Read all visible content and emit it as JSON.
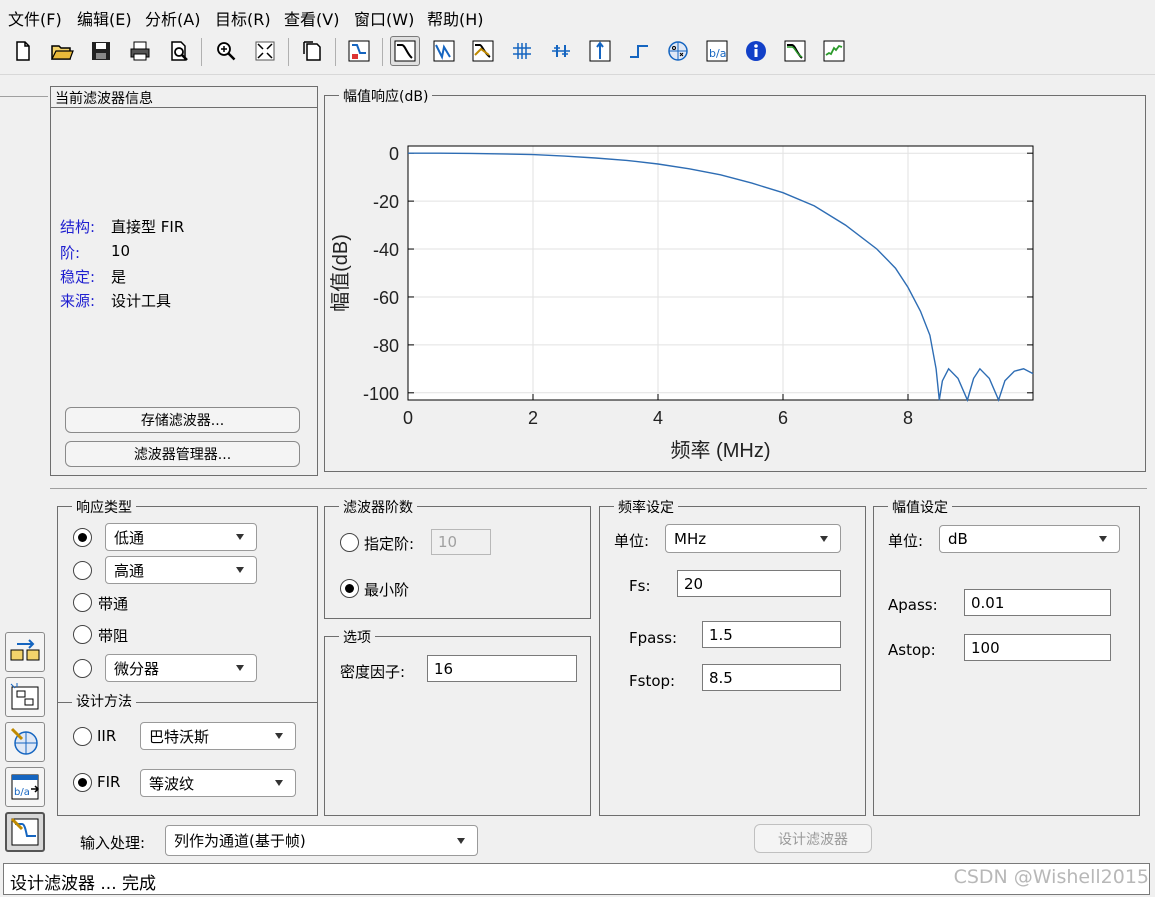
{
  "menu": [
    {
      "label": "文件(F)"
    },
    {
      "label": "编辑(E)"
    },
    {
      "label": "分析(A)"
    },
    {
      "label": "目标(R)"
    },
    {
      "label": "查看(V)"
    },
    {
      "label": "窗口(W)"
    },
    {
      "label": "帮助(H)"
    }
  ],
  "toolbar_icons": [
    "new-file-icon",
    "open-folder-icon",
    "save-icon",
    "print-icon",
    "print-preview-icon",
    "zoom-in-icon",
    "full-view-icon",
    "new-window-icon",
    "filter-spec-icon",
    "magnitude-response-icon",
    "phase-response-icon",
    "magnitude-phase-icon",
    "group-delay-icon",
    "phase-delay-icon",
    "impulse-response-icon",
    "step-response-icon",
    "pole-zero-icon",
    "coefficients-icon",
    "info-icon",
    "magnitude-estimate-icon",
    "round-off-noise-icon"
  ],
  "filter_info": {
    "title": "当前滤波器信息",
    "rows": [
      {
        "key": "结构:",
        "value": "直接型 FIR"
      },
      {
        "key": "阶:",
        "value": "10"
      },
      {
        "key": "稳定:",
        "value": "是"
      },
      {
        "key": "来源:",
        "value": "设计工具"
      }
    ],
    "store_button": "存储滤波器...",
    "manager_button": "滤波器管理器..."
  },
  "plot_panel": {
    "title": "幅值响应(dB)"
  },
  "chart_data": {
    "type": "line",
    "xlabel": "频率 (MHz)",
    "ylabel": "幅值(dB)",
    "xlim": [
      0,
      10
    ],
    "ylim": [
      -103,
      3
    ],
    "xticks": [
      0,
      2,
      4,
      6,
      8
    ],
    "yticks": [
      0,
      -20,
      -40,
      -60,
      -80,
      -100
    ],
    "grid": true,
    "series": [
      {
        "color": "#2e6db4",
        "x": [
          0,
          0.5,
          1,
          1.5,
          2,
          2.5,
          3,
          3.5,
          4,
          4.5,
          5,
          5.5,
          6,
          6.5,
          7,
          7.5,
          7.8,
          8,
          8.2,
          8.35,
          8.45,
          8.5,
          8.55,
          8.65,
          8.8,
          8.95,
          9.05,
          9.15,
          9.3,
          9.45,
          9.55,
          9.7,
          9.85,
          10
        ],
        "y": [
          0,
          0,
          -0.1,
          -0.3,
          -0.6,
          -1.2,
          -2,
          -3,
          -4.5,
          -6.5,
          -9,
          -12.5,
          -16.5,
          -22,
          -30,
          -40,
          -48,
          -56,
          -66,
          -76,
          -90,
          -103,
          -95,
          -90,
          -94,
          -103,
          -94,
          -90,
          -94,
          -103,
          -95,
          -91,
          -90,
          -92
        ]
      }
    ]
  },
  "response_type": {
    "title": "响应类型",
    "lowpass": "低通",
    "highpass": "高通",
    "bandpass": "带通",
    "bandstop": "带阻",
    "differentiator": "微分器"
  },
  "design_method": {
    "title": "设计方法",
    "iir_label": "IIR",
    "iir_select": "巴特沃斯",
    "fir_label": "FIR",
    "fir_select": "等波纹"
  },
  "filter_order": {
    "title": "滤波器阶数",
    "specify_label": "指定阶:",
    "specify_value": "10",
    "minimum_label": "最小阶"
  },
  "options": {
    "title": "选项",
    "density_label": "密度因子:",
    "density_value": "16"
  },
  "freq_spec": {
    "title": "频率设定",
    "unit_label": "单位:",
    "unit_value": "MHz",
    "fs_label": "Fs:",
    "fs_value": "20",
    "fpass_label": "Fpass:",
    "fpass_value": "1.5",
    "fstop_label": "Fstop:",
    "fstop_value": "8.5"
  },
  "mag_spec": {
    "title": "幅值设定",
    "unit_label": "单位:",
    "unit_value": "dB",
    "apass_label": "Apass:",
    "apass_value": "0.01",
    "astop_label": "Astop:",
    "astop_value": "100"
  },
  "input_processing": {
    "label": "输入处理:",
    "value": "列作为通道(基于帧)"
  },
  "design_button": "设计滤波器",
  "status": "设计滤波器 ... 完成",
  "watermark": "CSDN @Wishell2015"
}
